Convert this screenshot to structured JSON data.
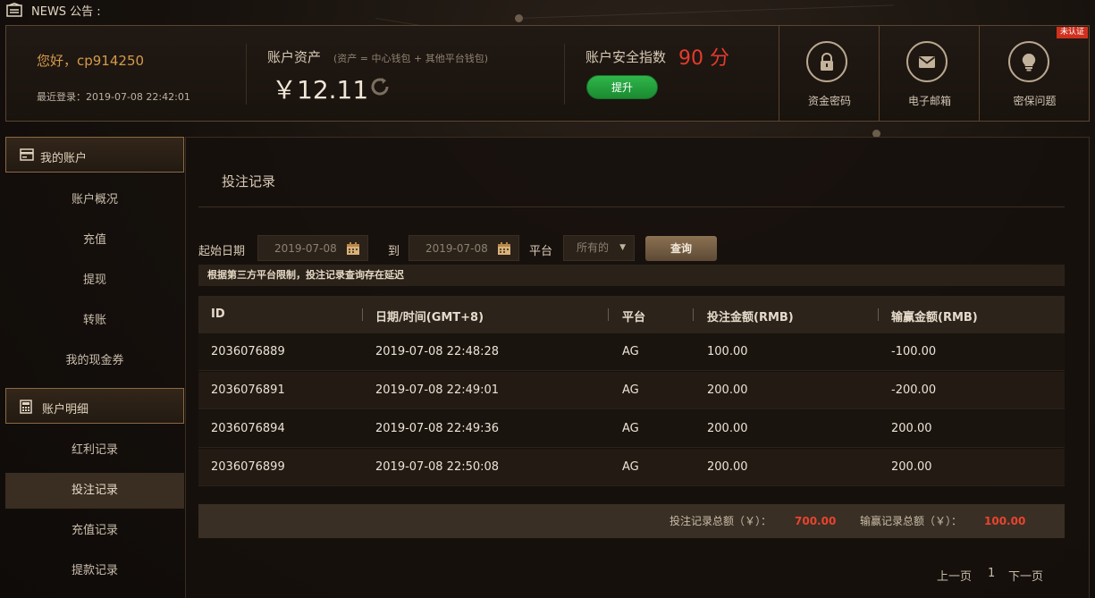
{
  "news": {
    "title": "NEWS 公告 :"
  },
  "header": {
    "greeting": "您好，cp914250",
    "last_login": "最近登录：2019-07-08 22:42:01",
    "assets_label": "账户资产",
    "assets_note": "(资产 = 中心钱包 + 其他平台钱包)",
    "assets_amount": "￥12.11",
    "security_label": "账户安全指数",
    "security_score": "90 分",
    "upgrade_label": "提升",
    "tiles": [
      {
        "label": "资金密码",
        "icon": "lock-icon"
      },
      {
        "label": "电子邮箱",
        "icon": "mail-icon"
      },
      {
        "label": "密保问题",
        "icon": "lightbulb-icon"
      }
    ],
    "unverified_badge": "未认证"
  },
  "sidebar": {
    "sections": [
      {
        "title": "我的账户",
        "icon": "card-icon",
        "items": [
          "账户概况",
          "充值",
          "提现",
          "转账",
          "我的现金券"
        ]
      },
      {
        "title": "账户明细",
        "icon": "calculator-icon",
        "items": [
          "红利记录",
          "投注记录",
          "充值记录",
          "提款记录"
        ]
      }
    ],
    "active_item": "投注记录"
  },
  "main": {
    "title": "投注记录",
    "filter": {
      "start_label": "起始日期",
      "start_value": "2019-07-08",
      "to_label": "到",
      "end_value": "2019-07-08",
      "platform_label": "平台",
      "platform_value": "所有的",
      "query_label": "查询"
    },
    "notice": "根据第三方平台限制，投注记录查询存在延迟",
    "table": {
      "headers": [
        "ID",
        "日期/时间(GMT+8)",
        "平台",
        "投注金额(RMB)",
        "输赢金额(RMB)"
      ],
      "rows": [
        [
          "2036076889",
          "2019-07-08 22:48:28",
          "AG",
          "100.00",
          "-100.00"
        ],
        [
          "2036076891",
          "2019-07-08 22:49:01",
          "AG",
          "200.00",
          "-200.00"
        ],
        [
          "2036076894",
          "2019-07-08 22:49:36",
          "AG",
          "200.00",
          "200.00"
        ],
        [
          "2036076899",
          "2019-07-08 22:50:08",
          "AG",
          "200.00",
          "200.00"
        ]
      ]
    },
    "summary": {
      "bet_label": "投注记录总额（￥）：",
      "bet_total": "700.00",
      "win_label": "输赢记录总额（￥）：",
      "win_total": "100.00"
    },
    "pager": {
      "prev": "上一页",
      "page": "1",
      "next": "下一页"
    }
  },
  "colors": {
    "accent": "#d59a4c",
    "score": "#e53b2e",
    "upgrade": "#2fb64a",
    "total": "#e8442f"
  }
}
